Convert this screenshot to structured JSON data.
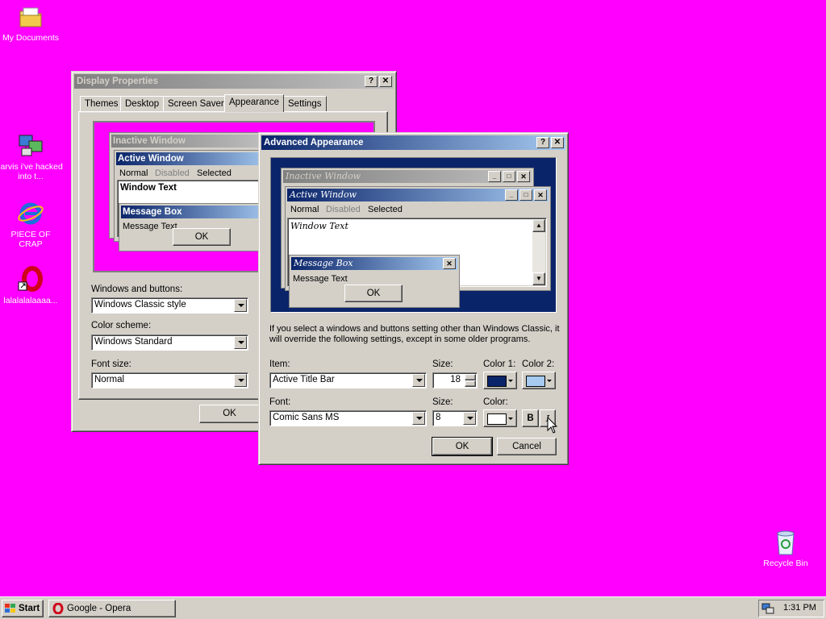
{
  "desktop": {
    "background_color": "#ff00ff",
    "icons": [
      {
        "label": "My Documents",
        "icon": "folder-icon"
      },
      {
        "label": "jarvis i've hacked into t...",
        "icon": "network-computer-icon"
      },
      {
        "label": "PIECE OF CRAP",
        "icon": "internet-explorer-icon"
      },
      {
        "label": "lalalalalaaaa...",
        "icon": "opera-shortcut-icon"
      },
      {
        "label": "Recycle Bin",
        "icon": "recycle-bin-icon"
      }
    ]
  },
  "display_properties": {
    "title": "Display Properties",
    "help_btn": "?",
    "close_btn": "✕",
    "tabs": [
      "Themes",
      "Desktop",
      "Screen Saver",
      "Appearance",
      "Settings"
    ],
    "selected_tab": "Appearance",
    "preview": {
      "inactive_title": "Inactive Window",
      "active_title": "Active Window",
      "menu_normal": "Normal",
      "menu_disabled": "Disabled",
      "menu_selected": "Selected",
      "window_text": "Window Text",
      "msgbox_title": "Message Box",
      "msgbox_text": "Message Text",
      "msgbox_ok": "OK"
    },
    "windows_buttons_label": "Windows and buttons:",
    "windows_buttons_value": "Windows Classic style",
    "color_scheme_label": "Color scheme:",
    "color_scheme_value": "Windows Standard",
    "font_size_label": "Font size:",
    "font_size_value": "Normal",
    "ok_label": "OK"
  },
  "advanced_appearance": {
    "title": "Advanced Appearance",
    "help_btn": "?",
    "close_btn": "✕",
    "preview": {
      "inactive_title": "Inactive Window",
      "active_title": "Active Window",
      "menu_normal": "Normal",
      "menu_disabled": "Disabled",
      "menu_selected": "Selected",
      "window_text": "Window Text",
      "msgbox_title": "Message Box",
      "msgbox_text": "Message Text",
      "msgbox_ok": "OK"
    },
    "info_text": "If you select a windows and buttons setting other than Windows Classic, it will override the following settings, except in some older programs.",
    "item_label": "Item:",
    "item_value": "Active Title Bar",
    "size_label": "Size:",
    "size_value": "18",
    "color1_label": "Color 1:",
    "color1_value": "#0a246a",
    "color2_label": "Color 2:",
    "color2_value": "#a6caf0",
    "font_label": "Font:",
    "font_value": "Comic Sans MS",
    "font_size_label": "Size:",
    "font_size_value": "8",
    "font_color_label": "Color:",
    "font_color_value": "#ffffff",
    "bold_label": "B",
    "italic_label": "I",
    "ok_label": "OK",
    "cancel_label": "Cancel"
  },
  "taskbar": {
    "start_label": "Start",
    "tasks": [
      {
        "label": "Google - Opera",
        "icon": "opera-icon"
      }
    ],
    "clock": "1:31 PM"
  }
}
